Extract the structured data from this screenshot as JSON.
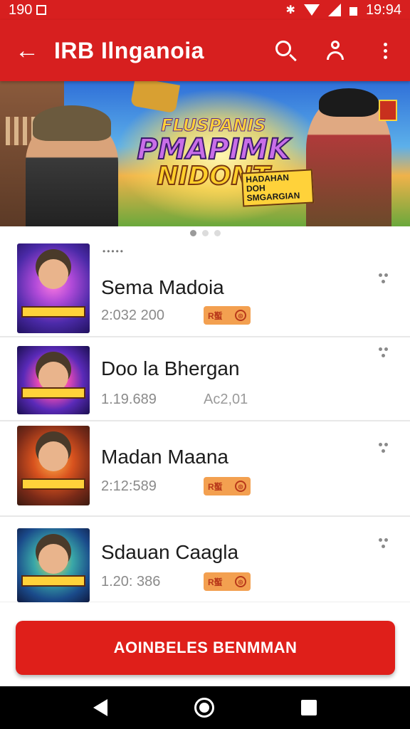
{
  "statusbar": {
    "left_text": "190",
    "time": "19:94"
  },
  "appbar": {
    "title": "IRB Ilnganoia"
  },
  "banner": {
    "headline_1": "FLUSPANIS",
    "headline_2": "PMAPIMK",
    "headline_3": "NIDONT",
    "subtext": "HADAHAN DOH SMGARGIAN"
  },
  "pager": {
    "count": 3,
    "active": 0
  },
  "list": [
    {
      "rank": "•••••",
      "name": "Sema Madoia",
      "meta": "2:032 200",
      "price_label": "R蟴",
      "price_icon": "◎"
    },
    {
      "name": "Doo la Bhergan",
      "meta": "1.19.689",
      "extra": "Ac2,01"
    },
    {
      "name": "Madan Maana",
      "meta": "2:12:589",
      "price_label": "R蟴",
      "price_icon": "◎"
    },
    {
      "name": "Sdauan Caagla",
      "meta": "1.20: 386",
      "price_label": "R蟴",
      "price_icon": "◎"
    }
  ],
  "cta": {
    "label": "AOINBELES BENMMAN"
  },
  "colors": {
    "primary": "#d71f1f",
    "cta": "#df1f1a",
    "price_bg": "#f3a050"
  }
}
